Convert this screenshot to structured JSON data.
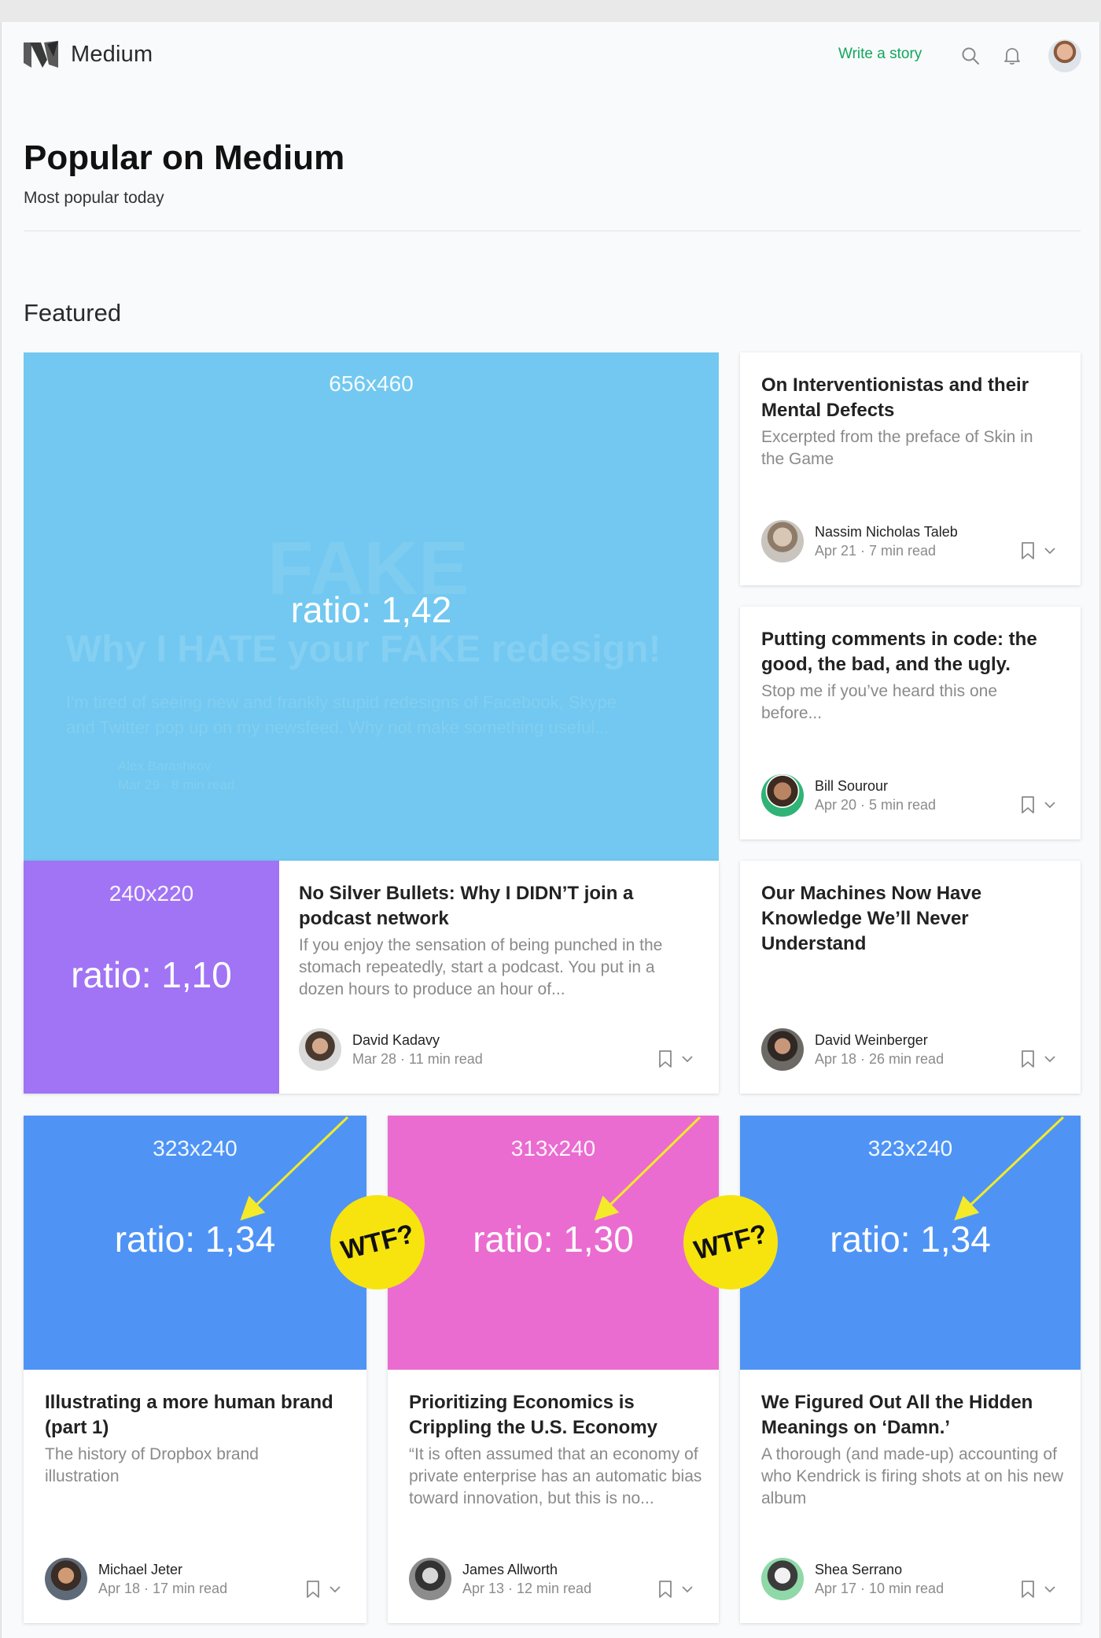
{
  "header": {
    "logo_text": "Medium",
    "write_label": "Write a story",
    "icons": [
      "medium-logo-icon",
      "search-icon",
      "bell-icon",
      "avatar"
    ]
  },
  "page": {
    "title": "Popular on Medium",
    "subtitle": "Most popular today",
    "section": "Featured"
  },
  "featured_main": {
    "dims": "656x460",
    "ratio": "ratio: 1,42",
    "ghost_title": "Why I HATE your FAKE redesign!",
    "ghost_word": "FAKE",
    "ghost_line1": "I'm tired of seeing new and frankly stupid redesigns of Facebook, Skype",
    "ghost_line2": "and Twitter pop up on my newsfeed. Why not make something useful...",
    "ghost_author": "Alex Barashkov",
    "ghost_date": "Mar 29 · 8 min read",
    "color": "#72c8f0"
  },
  "side_cards": [
    {
      "title": "On Interventionistas and their Mental Defects",
      "excerpt": "Excerpted from the preface of Skin in the Game",
      "author": "Nassim Nicholas Taleb",
      "date": "Apr 21 · 7 min read"
    },
    {
      "title": "Putting comments in code: the good, the bad, and the ugly.",
      "excerpt": "Stop me if you’ve heard this one before...",
      "author": "Bill Sourour",
      "date": "Apr 20 · 5 min read"
    },
    {
      "title": "Our Machines Now Have Knowledge We’ll Never Understand",
      "excerpt": "",
      "author": "David Weinberger",
      "date": "Apr 18 · 26 min read"
    }
  ],
  "wide_card": {
    "dims": "240x220",
    "ratio": "ratio: 1,10",
    "color": "#a074f4",
    "title": "No Silver Bullets: Why I DIDN’T join a podcast network",
    "excerpt": "If you enjoy the sensation of being punched in the stomach repeatedly, start a podcast. You put in a dozen hours to produce an hour of...",
    "author": "David Kadavy",
    "date": "Mar 28 · 11 min read"
  },
  "grid_cards": [
    {
      "dims": "323x240",
      "ratio": "ratio: 1,34",
      "color": "#4f94f5",
      "title": "Illustrating a more human brand (part 1)",
      "excerpt": "The history of Dropbox brand illustration",
      "author": "Michael Jeter",
      "date": "Apr 18 · 17 min read"
    },
    {
      "dims": "313x240",
      "ratio": "ratio: 1,30",
      "color": "#ea6cd0",
      "title": "Prioritizing Economics is Crippling the U.S. Economy",
      "excerpt": "“It is often assumed that an economy of private enterprise has an automatic bias toward innovation, but this is no...",
      "author": "James Allworth",
      "date": "Apr 13 · 12 min read"
    },
    {
      "dims": "323x240",
      "ratio": "ratio: 1,34",
      "color": "#4f94f5",
      "title": "We Figured Out All the Hidden Meanings on ‘Damn.’",
      "excerpt": "A thorough (and made-up) accounting of who Kendrick is firing shots at on his new album",
      "author": "Shea Serrano",
      "date": "Apr 17 · 10 min read"
    }
  ],
  "annotations": {
    "wtf1": "WTF?",
    "wtf2": "WTF?",
    "arrow_color": "#f4ea2a",
    "badge_color": "#f7e40f"
  },
  "colors": {
    "accent_green": "#11a75b",
    "page_bg": "#f9fafc"
  }
}
